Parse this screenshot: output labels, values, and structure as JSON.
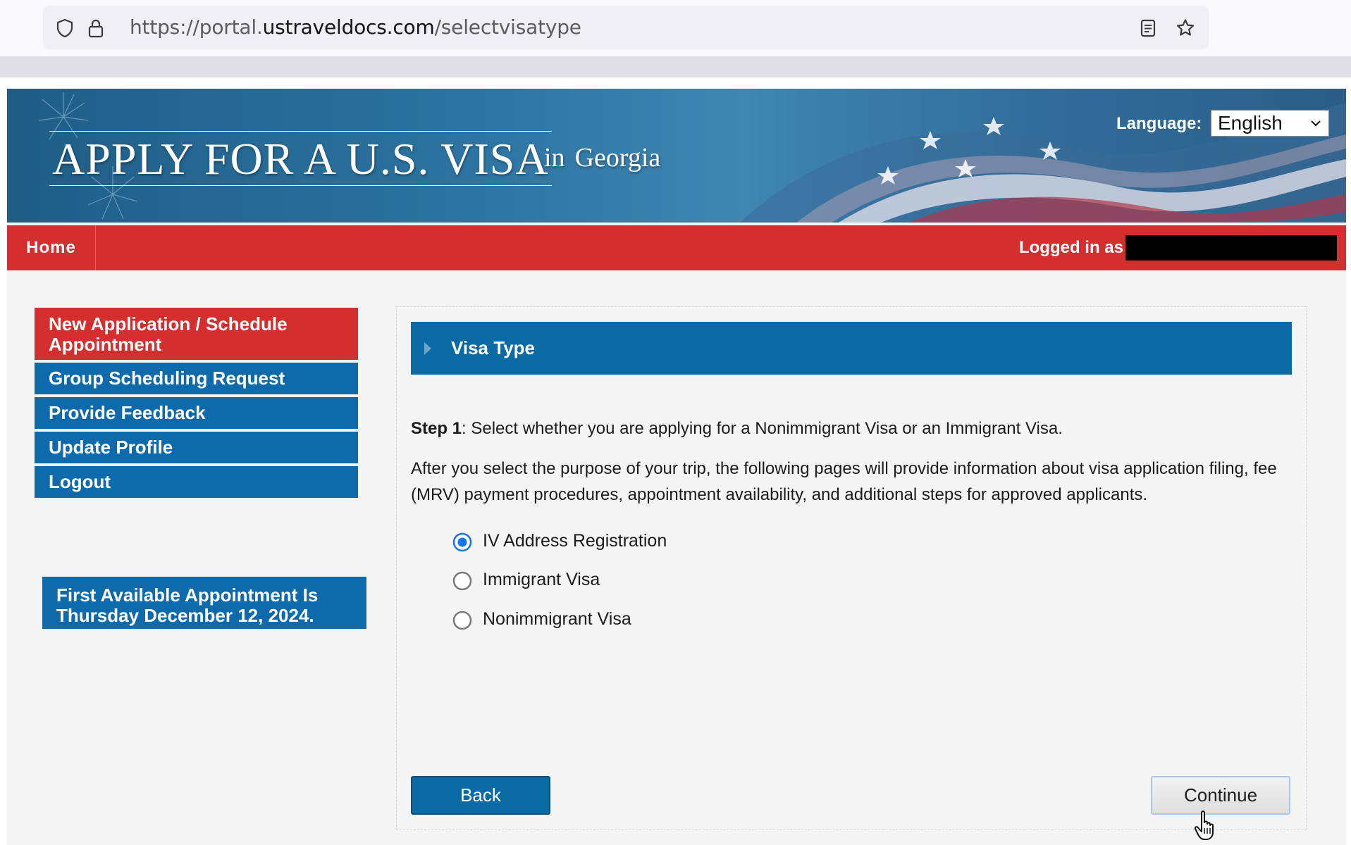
{
  "browser": {
    "url_scheme": "https://portal.",
    "url_host": "ustraveldocs.com",
    "url_path": "/selectvisatype"
  },
  "header": {
    "title": "APPLY FOR A U.S. VISA",
    "in_label": "in",
    "country": "Georgia",
    "language_label": "Language:",
    "language_value": "English"
  },
  "navbar": {
    "home": "Home",
    "logged_in_label": "Logged in as"
  },
  "sidebar": {
    "items": [
      {
        "label": "New Application / Schedule Appointment",
        "color": "#d42f2f"
      },
      {
        "label": "Group Scheduling Request",
        "color": "#0f6aab"
      },
      {
        "label": "Provide Feedback",
        "color": "#0f6aab"
      },
      {
        "label": "Update Profile",
        "color": "#0f6aab"
      },
      {
        "label": "Logout",
        "color": "#0f6aab"
      }
    ],
    "appointment": "First Available Appointment Is Thursday December 12, 2024."
  },
  "main": {
    "section_title": "Visa Type",
    "step_label": "Step 1",
    "step_text": ": Select whether you are applying for a Nonimmigrant Visa or an Immigrant Visa.",
    "description": "After you select the purpose of your trip, the following pages will provide information about visa application filing, fee (MRV) payment procedures, appointment availability, and additional steps for approved applicants.",
    "options": [
      {
        "label": "IV Address Registration",
        "selected": true
      },
      {
        "label": "Immigrant Visa",
        "selected": false
      },
      {
        "label": "Nonimmigrant Visa",
        "selected": false
      }
    ],
    "back_button": "Back",
    "continue_button": "Continue"
  },
  "colors": {
    "brand_red": "#d42f2f",
    "brand_blue": "#0a6aa4",
    "radio_selected": "#1a73e8"
  }
}
